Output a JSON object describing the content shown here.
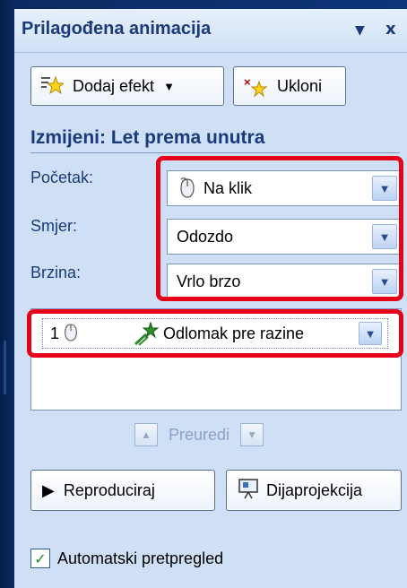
{
  "panel": {
    "title": "Prilagođena animacija",
    "menu_icon": "dropdown-triangle-icon",
    "close_glyph": "x"
  },
  "toolbar": {
    "add_effect_label": "Dodaj efekt",
    "add_effect_icon": "star-effect-icon",
    "remove_label": "Ukloni",
    "remove_icon": "remove-effect-icon"
  },
  "modify": {
    "title": "Izmijeni: Let prema unutra",
    "start_label": "Početak:",
    "start_value": "Na klik",
    "direction_label": "Smjer:",
    "direction_value": "Odozdo",
    "speed_label": "Brzina:",
    "speed_value": "Vrlo brzo"
  },
  "list": {
    "items": [
      {
        "index": "1",
        "name": "Odlomak pre razine",
        "trigger_icon": "mouse-icon",
        "effect_icon": "fly-in-star-icon"
      }
    ]
  },
  "reorder": {
    "label": "Preuredi"
  },
  "actions": {
    "play_label": "Reproduciraj",
    "slideshow_label": "Dijaprojekcija"
  },
  "options": {
    "autopreview_label": "Automatski pretpregled",
    "autopreview_checked": true
  },
  "colors": {
    "highlight_red": "#e60018",
    "title_blue": "#1a3a7a",
    "panel_bg": "#cfe0f6"
  }
}
